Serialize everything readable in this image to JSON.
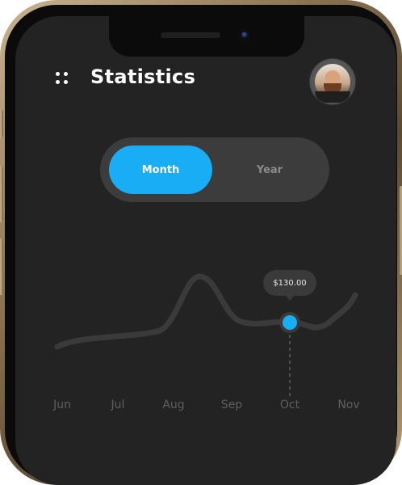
{
  "header": {
    "title": "Statistics",
    "menu_icon": "grid-dots-icon",
    "avatar_icon": "user-avatar"
  },
  "period_toggle": {
    "options": [
      "Month",
      "Year"
    ],
    "selected": "Month"
  },
  "tooltip": {
    "value": "$130.00"
  },
  "colors": {
    "accent": "#18adf5",
    "background": "#232323",
    "line": "#3a3a3a"
  },
  "chart_data": {
    "type": "line",
    "categories": [
      "Jun",
      "Jul",
      "Aug",
      "Sep",
      "Oct",
      "Nov"
    ],
    "highlighted_category": "Oct",
    "highlighted_value": 130,
    "title": "",
    "xlabel": "",
    "ylabel": ""
  }
}
